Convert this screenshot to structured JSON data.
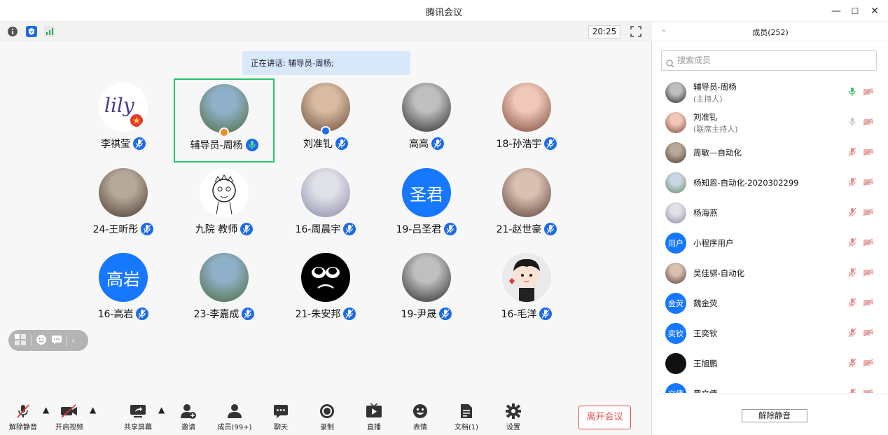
{
  "app": {
    "title": "腾讯会议"
  },
  "window_controls": {
    "minimize": "—",
    "maximize": "☐",
    "close": "✕"
  },
  "top_strip": {
    "time": "20:25"
  },
  "speaking_banner": "正在讲话: 辅导员-周杨;",
  "participants_grid": [
    {
      "name": "李祺莹",
      "avatar": "lily-logo"
    },
    {
      "name": "辅导员-周杨",
      "avatar": "photo",
      "active": true,
      "host": true
    },
    {
      "name": "刘准钆",
      "avatar": "photo",
      "cohost": true
    },
    {
      "name": "高高",
      "avatar": "photo"
    },
    {
      "name": "18-孙浩宇",
      "avatar": "photo"
    },
    {
      "name": "24-王昕彤",
      "avatar": "photo"
    },
    {
      "name": "九院 教师",
      "avatar": "cartoon"
    },
    {
      "name": "16-周晨宇",
      "avatar": "photo"
    },
    {
      "name": "19-吕圣君",
      "avatar": "text",
      "avatar_text": "圣君"
    },
    {
      "name": "21-赵世豪",
      "avatar": "photo"
    },
    {
      "name": "16-高岩",
      "avatar": "text",
      "avatar_text": "高岩"
    },
    {
      "name": "23-李嘉成",
      "avatar": "photo"
    },
    {
      "name": "21-朱安邦",
      "avatar": "black-face"
    },
    {
      "name": "19-尹晟",
      "avatar": "photo"
    },
    {
      "name": "16-毛洋",
      "avatar": "cartoon-boy"
    }
  ],
  "toolbar": {
    "unmute": "解除静音",
    "start_video": "开启视频",
    "share_screen": "共享屏幕",
    "invite": "邀请",
    "members": "成员(99+)",
    "chat": "聊天",
    "record": "录制",
    "live": "直播",
    "emoji": "表情",
    "docs": "文档(1)",
    "settings": "设置",
    "leave": "离开会议"
  },
  "panel": {
    "title": "成员(252)",
    "search_placeholder": "搜索成员",
    "members": [
      {
        "name": "辅导员-周杨",
        "role": "(主持人)",
        "avatar": "photo",
        "mic": "active"
      },
      {
        "name": "刘准钆",
        "role": "(联席主持人)",
        "avatar": "photo",
        "mic": "idle"
      },
      {
        "name": "周敏—自动化",
        "avatar": "photo",
        "mic": "muted"
      },
      {
        "name": "杨知恩-自动化-2020302299",
        "avatar": "photo",
        "mic": "muted"
      },
      {
        "name": "杨海燕",
        "avatar": "photo",
        "mic": "muted"
      },
      {
        "name": "小程序用户",
        "avatar": "text",
        "avatar_text": "用户",
        "mic": "muted"
      },
      {
        "name": "吴佳骐-自动化",
        "avatar": "photo",
        "mic": "muted"
      },
      {
        "name": "魏金荧",
        "avatar": "text",
        "avatar_text": "金荧",
        "mic": "muted"
      },
      {
        "name": "王奕钦",
        "avatar": "text",
        "avatar_text": "奕钦",
        "mic": "muted"
      },
      {
        "name": "王旭鹏",
        "avatar": "black",
        "mic": "muted"
      },
      {
        "name": "童文倩",
        "avatar": "text",
        "avatar_text": "文倩",
        "mic": "muted"
      }
    ],
    "unmute_all": "解除静音"
  },
  "colors": {
    "accent": "#1677ff",
    "active_border": "#25c66a",
    "leave": "#e14b4b"
  }
}
